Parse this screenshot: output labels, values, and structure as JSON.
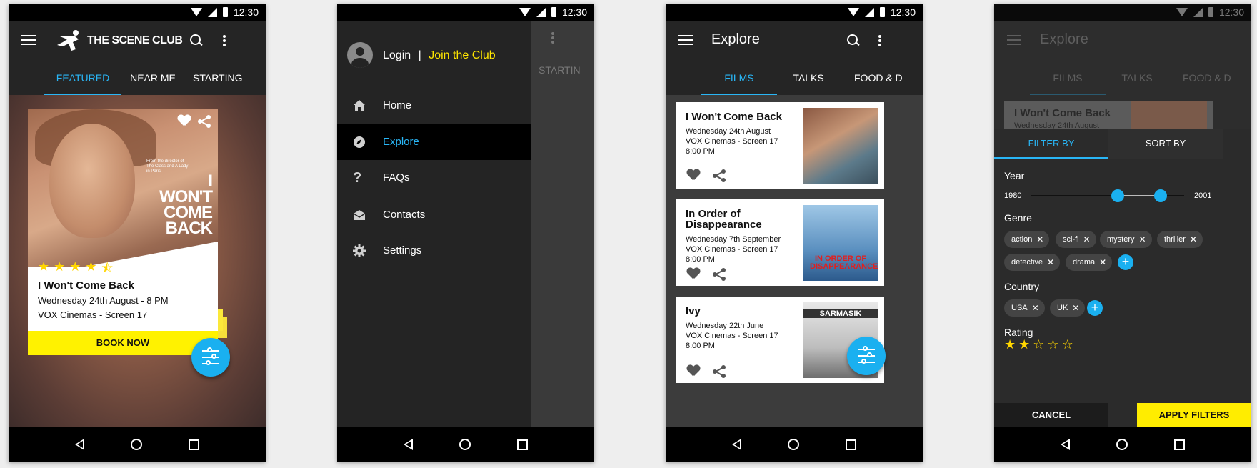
{
  "status": {
    "time": "12:30"
  },
  "screen1": {
    "logo": "THE SCENE CLUB",
    "tabs": [
      "FEATURED",
      "NEAR ME",
      "STARTING"
    ],
    "card": {
      "poster_lines": [
        "I",
        "WON'T",
        "COME",
        "BACK"
      ],
      "poster_small": "From the director of The Class and A Lady in Paris",
      "rating": 4.5,
      "title": "I Won't Come Back",
      "date": "Wednesday 24th August - 8 PM",
      "venue": "VOX Cinemas - Screen 17",
      "book": "BOOK NOW"
    }
  },
  "screen2": {
    "login": "Login",
    "separator": "|",
    "join": "Join the Club",
    "items": [
      {
        "label": "Home",
        "icon": "home-icon"
      },
      {
        "label": "Explore",
        "icon": "compass-icon"
      },
      {
        "label": "FAQs",
        "icon": "question-icon"
      },
      {
        "label": "Contacts",
        "icon": "mail-icon"
      },
      {
        "label": "Settings",
        "icon": "gear-icon"
      }
    ],
    "behind_tab": "STARTIN"
  },
  "screen3": {
    "title": "Explore",
    "tabs": [
      "FILMS",
      "TALKS",
      "FOOD & D"
    ],
    "films": [
      {
        "title": "I Won't Come Back",
        "date": "Wednesday 24th August",
        "venue": "VOX Cinemas - Screen 17",
        "time": "8:00 PM"
      },
      {
        "title": "In Order of Disappearance",
        "date": "Wednesday 7th September",
        "venue": "VOX Cinemas - Screen 17",
        "time": "8:00 PM"
      },
      {
        "title": "Ivy",
        "date": "Wednesday 22th June",
        "venue": "VOX Cinemas - Screen 17",
        "time": "8:00 PM"
      }
    ],
    "poster2_text": "IN ORDER OF DISAPPEARANCE",
    "poster3_text": "SARMASIK"
  },
  "screen4": {
    "title": "Explore",
    "tabs": [
      "FILMS",
      "TALKS",
      "FOOD & D"
    ],
    "peek_title": "I Won't Come Back",
    "peek_date": "Wednesday 24th August",
    "filter_tab": "FILTER BY",
    "sort_tab": "SORT BY",
    "year_label": "Year",
    "year_min": "1980",
    "year_max": "2001",
    "genre_label": "Genre",
    "genres": [
      "action",
      "sci-fi",
      "mystery",
      "thriller",
      "detective",
      "drama"
    ],
    "country_label": "Country",
    "countries": [
      "USA",
      "UK"
    ],
    "rating_label": "Rating",
    "rating": 2,
    "cancel": "CANCEL",
    "apply": "APPLY FILTERS"
  },
  "colors": {
    "accent": "#29b6f6",
    "yellow": "#ffed00",
    "fab": "#1ab0f0"
  }
}
